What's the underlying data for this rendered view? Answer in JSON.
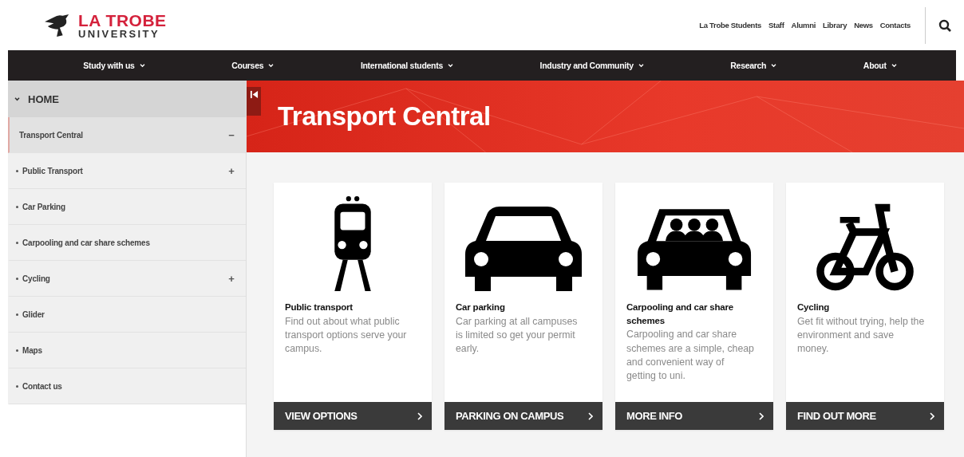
{
  "logo": {
    "line1": "LA TROBE",
    "line2": "UNIVERSITY"
  },
  "top_links": [
    "La Trobe Students",
    "Staff",
    "Alumni",
    "Library",
    "News",
    "Contacts"
  ],
  "nav": [
    "Study with us",
    "Courses",
    "International students",
    "Industry and Community",
    "Research",
    "About"
  ],
  "sidebar": {
    "home": "HOME",
    "items": [
      {
        "label": "Transport Central",
        "selected": true,
        "bullet": false,
        "toggle": "−"
      },
      {
        "label": "Public Transport",
        "selected": false,
        "bullet": true,
        "toggle": "+"
      },
      {
        "label": "Car Parking",
        "selected": false,
        "bullet": true
      },
      {
        "label": "Carpooling and car share schemes",
        "selected": false,
        "bullet": true
      },
      {
        "label": "Cycling",
        "selected": false,
        "bullet": true,
        "toggle": "+"
      },
      {
        "label": "Glider",
        "selected": false,
        "bullet": true
      },
      {
        "label": "Maps",
        "selected": false,
        "bullet": true
      },
      {
        "label": "Contact us",
        "selected": false,
        "bullet": true
      }
    ]
  },
  "banner": {
    "title": "Transport Central"
  },
  "cards": [
    {
      "kind": "train",
      "title": "Public transport",
      "text": "Find out about what public transport options serve your campus.",
      "button": "VIEW OPTIONS"
    },
    {
      "kind": "car",
      "title": "Car parking",
      "text": "Car parking at all campuses is limited so get your permit early.",
      "button": "PARKING ON CAMPUS"
    },
    {
      "kind": "carpool",
      "title": "Carpooling and car share schemes",
      "text": "Carpooling and car share schemes are a simple, cheap and convenient way of getting to uni.",
      "button": "MORE INFO"
    },
    {
      "kind": "bicycle",
      "title": "Cycling",
      "text": "Get fit without trying, help the environment and save money.",
      "button": "FIND OUT MORE"
    }
  ]
}
